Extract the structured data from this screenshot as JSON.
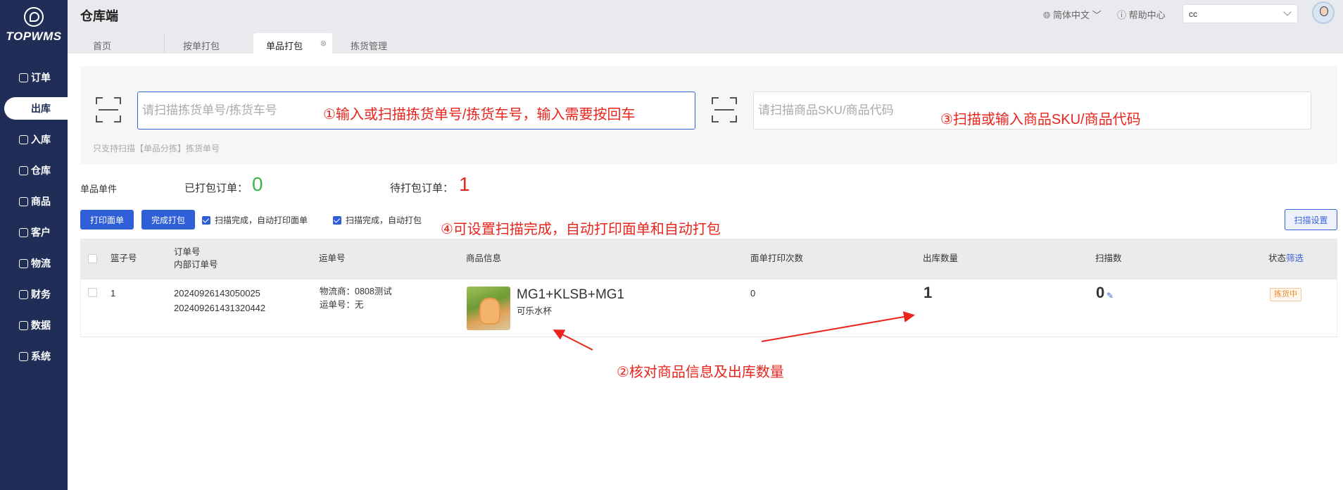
{
  "app": {
    "logo_text": "TOPWMS",
    "title": "仓库端"
  },
  "sidebar": {
    "items": [
      {
        "label": "订单"
      },
      {
        "label": "出库"
      },
      {
        "label": "入库"
      },
      {
        "label": "仓库"
      },
      {
        "label": "商品"
      },
      {
        "label": "客户"
      },
      {
        "label": "物流"
      },
      {
        "label": "财务"
      },
      {
        "label": "数据"
      },
      {
        "label": "系统"
      }
    ],
    "active_index": 1
  },
  "header": {
    "language": "简体中文",
    "help": "帮助中心",
    "user_select": "cc"
  },
  "tabs": [
    {
      "label": "首页"
    },
    {
      "label": "按单打包"
    },
    {
      "label": "单品打包",
      "closable": true,
      "close_icon": "⊗"
    },
    {
      "label": "拣货管理"
    }
  ],
  "scan": {
    "picking_placeholder": "请扫描拣货单号/拣货车号",
    "sku_placeholder": "请扫描商品SKU/商品代码",
    "hint": "只支持扫描【单品分拣】拣货单号"
  },
  "stats": {
    "mode": "单品单件",
    "packed_label": "已打包订单：",
    "packed_value": "0",
    "pending_label": "待打包订单：",
    "pending_value": "1"
  },
  "actions": {
    "print_label": "打印面单",
    "finish_label": "完成打包",
    "auto_print_label": "扫描完成，自动打印面单",
    "auto_pack_label": "扫描完成，自动打包",
    "settings_label": "扫描设置"
  },
  "table": {
    "headers": {
      "basket": "篮子号",
      "order_no": "订单号",
      "internal_order_no": "内部订单号",
      "waybill": "运单号",
      "product": "商品信息",
      "print_count": "面单打印次数",
      "out_qty": "出库数量",
      "scan_count": "扫描数",
      "status": "状态",
      "filter": "筛选"
    },
    "rows": [
      {
        "basket": "1",
        "order_no": "20240926143050025",
        "internal_order_no": "202409261431320442",
        "carrier": "物流商：0808测试",
        "waybill": "运单号：无",
        "product_name": "MG1+KLSB+MG1",
        "product_desc": "可乐水杯",
        "print_count": "0",
        "out_qty": "1",
        "scan_count": "0",
        "status": "拣货中"
      }
    ]
  },
  "annotations": {
    "a1": "①输入或扫描拣货单号/拣货车号，输入需要按回车",
    "a2": "②核对商品信息及出库数量",
    "a3": "③扫描或输入商品SKU/商品代码",
    "a4": "④可设置扫描完成，自动打印面单和自动打包"
  },
  "colors": {
    "sidebar": "#1f2d57",
    "primary": "#2f5fd6",
    "annotation": "#e8241d",
    "packed": "#3cb44b",
    "pending": "#e8241d"
  }
}
